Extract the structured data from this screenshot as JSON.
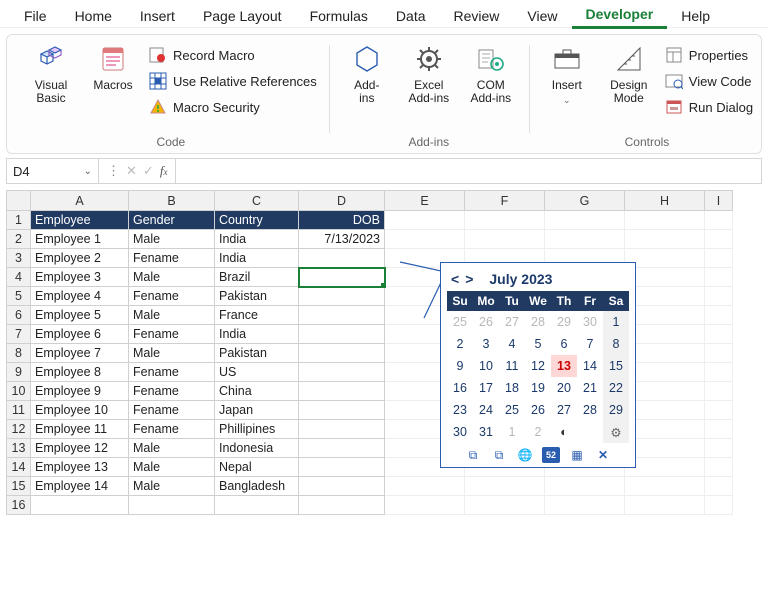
{
  "menu": {
    "items": [
      "File",
      "Home",
      "Insert",
      "Page Layout",
      "Formulas",
      "Data",
      "Review",
      "View",
      "Developer",
      "Help"
    ],
    "active": "Developer"
  },
  "ribbon": {
    "code": {
      "label": "Code",
      "visual_basic": "Visual\nBasic",
      "macros": "Macros",
      "record_macro": "Record Macro",
      "use_relative": "Use Relative References",
      "macro_security": "Macro Security"
    },
    "addins": {
      "label": "Add-ins",
      "add_ins": "Add-\nins",
      "excel_addins": "Excel\nAdd-ins",
      "com_addins": "COM\nAdd-ins"
    },
    "controls": {
      "label": "Controls",
      "insert": "Insert",
      "design_mode": "Design\nMode",
      "properties": "Properties",
      "view_code": "View Code",
      "run_dialog": "Run Dialog"
    }
  },
  "name_box": "D4",
  "formula": "",
  "columns": [
    "A",
    "B",
    "C",
    "D",
    "E",
    "F",
    "G",
    "H",
    "I"
  ],
  "headers": [
    "Employee",
    "Gender",
    "Country",
    "DOB"
  ],
  "rows": [
    {
      "n": "1",
      "employee": "Employee",
      "gender": "Gender",
      "country": "Country",
      "dob": "DOB",
      "is_header": true
    },
    {
      "n": "2",
      "employee": "Employee 1",
      "gender": "Male",
      "country": "India",
      "dob": "7/13/2023"
    },
    {
      "n": "3",
      "employee": "Employee 2",
      "gender": "Fename",
      "country": "India",
      "dob": ""
    },
    {
      "n": "4",
      "employee": "Employee 3",
      "gender": "Male",
      "country": "Brazil",
      "dob": ""
    },
    {
      "n": "5",
      "employee": "Employee 4",
      "gender": "Fename",
      "country": "Pakistan",
      "dob": ""
    },
    {
      "n": "6",
      "employee": "Employee 5",
      "gender": "Male",
      "country": "France",
      "dob": ""
    },
    {
      "n": "7",
      "employee": "Employee 6",
      "gender": "Fename",
      "country": "India",
      "dob": ""
    },
    {
      "n": "8",
      "employee": "Employee 7",
      "gender": "Male",
      "country": "Pakistan",
      "dob": ""
    },
    {
      "n": "9",
      "employee": "Employee 8",
      "gender": "Fename",
      "country": "US",
      "dob": ""
    },
    {
      "n": "10",
      "employee": "Employee 9",
      "gender": "Fename",
      "country": "China",
      "dob": ""
    },
    {
      "n": "11",
      "employee": "Employee 10",
      "gender": "Fename",
      "country": "Japan",
      "dob": ""
    },
    {
      "n": "12",
      "employee": "Employee 11",
      "gender": "Fename",
      "country": "Phillipines",
      "dob": ""
    },
    {
      "n": "13",
      "employee": "Employee 12",
      "gender": "Male",
      "country": "Indonesia",
      "dob": ""
    },
    {
      "n": "14",
      "employee": "Employee 13",
      "gender": "Male",
      "country": "Nepal",
      "dob": ""
    },
    {
      "n": "15",
      "employee": "Employee 14",
      "gender": "Male",
      "country": "Bangladesh",
      "dob": ""
    },
    {
      "n": "16",
      "employee": "",
      "gender": "",
      "country": "",
      "dob": ""
    }
  ],
  "selected_cell": "D4",
  "calendar": {
    "title": "July 2023",
    "dow": [
      "Su",
      "Mo",
      "Tu",
      "We",
      "Th",
      "Fr",
      "Sa"
    ],
    "weeks": [
      [
        {
          "d": "25",
          "dim": true
        },
        {
          "d": "26",
          "dim": true
        },
        {
          "d": "27",
          "dim": true
        },
        {
          "d": "28",
          "dim": true
        },
        {
          "d": "29",
          "dim": true
        },
        {
          "d": "30",
          "dim": true
        },
        {
          "d": "1",
          "we": true
        }
      ],
      [
        {
          "d": "2"
        },
        {
          "d": "3"
        },
        {
          "d": "4"
        },
        {
          "d": "5"
        },
        {
          "d": "6"
        },
        {
          "d": "7"
        },
        {
          "d": "8",
          "we": true
        }
      ],
      [
        {
          "d": "9"
        },
        {
          "d": "10"
        },
        {
          "d": "11"
        },
        {
          "d": "12"
        },
        {
          "d": "13",
          "today": true
        },
        {
          "d": "14"
        },
        {
          "d": "15",
          "we": true
        }
      ],
      [
        {
          "d": "16"
        },
        {
          "d": "17"
        },
        {
          "d": "18"
        },
        {
          "d": "19"
        },
        {
          "d": "20"
        },
        {
          "d": "21"
        },
        {
          "d": "22",
          "we": true
        }
      ],
      [
        {
          "d": "23"
        },
        {
          "d": "24"
        },
        {
          "d": "25"
        },
        {
          "d": "26"
        },
        {
          "d": "27"
        },
        {
          "d": "28"
        },
        {
          "d": "29",
          "we": true
        }
      ],
      [
        {
          "d": "30"
        },
        {
          "d": "31"
        },
        {
          "d": "1",
          "dim": true
        },
        {
          "d": "2",
          "dim": true
        },
        {
          "d": "",
          "icon": "clock"
        },
        {
          "d": ""
        },
        {
          "d": "",
          "icon": "gear",
          "we": true
        }
      ]
    ]
  }
}
